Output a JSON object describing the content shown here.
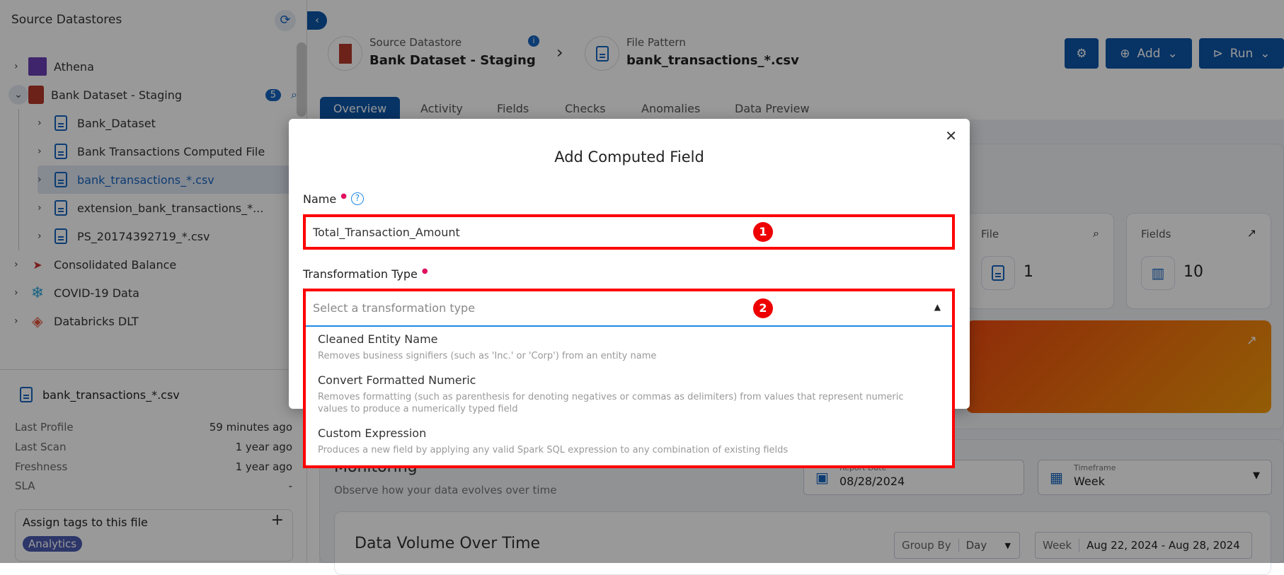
{
  "sidebar": {
    "title": "Source Datastores",
    "items": [
      {
        "label": "Athena"
      },
      {
        "label": "Bank Dataset - Staging",
        "badge": "5"
      },
      {
        "label": "Bank_Dataset"
      },
      {
        "label": "Bank Transactions Computed File"
      },
      {
        "label": "bank_transactions_*.csv"
      },
      {
        "label": "extension_bank_transactions_*..."
      },
      {
        "label": "PS_20174392719_*.csv"
      },
      {
        "label": "Consolidated Balance"
      },
      {
        "label": "COVID-19 Data"
      },
      {
        "label": "Databricks DLT"
      }
    ],
    "file": {
      "name": "bank_transactions_*.csv",
      "meta": [
        {
          "k": "Last Profile",
          "v": "59 minutes ago"
        },
        {
          "k": "Last Scan",
          "v": "1 year ago"
        },
        {
          "k": "Freshness",
          "v": "1 year ago"
        },
        {
          "k": "SLA",
          "v": "-"
        }
      ],
      "tags_label": "Assign tags to this file",
      "tags": [
        "Analytics"
      ]
    }
  },
  "header": {
    "ds_label": "Source Datastore",
    "ds_name": "Bank Dataset - Staging",
    "fp_label": "File Pattern",
    "fp_name": "bank_transactions_*.csv",
    "add": "Add",
    "run": "Run"
  },
  "tabs": [
    "Overview",
    "Activity",
    "Fields",
    "Checks",
    "Anomalies",
    "Data Preview"
  ],
  "cards": {
    "file_label": "File",
    "file_value": "1",
    "fields_label": "Fields",
    "fields_value": "10"
  },
  "monitoring": {
    "title": "Monitoring",
    "subtitle": "Observe how your data evolves over time",
    "report_date_label": "Report Date",
    "report_date": "08/28/2024",
    "timeframe_label": "Timeframe",
    "timeframe": "Week"
  },
  "volume": {
    "title": "Data Volume Over Time",
    "group_by_label": "Group By",
    "group_by": "Day",
    "range_label": "Week",
    "range": "Aug 22, 2024 - Aug 28, 2024"
  },
  "modal": {
    "title": "Add Computed Field",
    "name_label": "Name",
    "name_value": "Total_Transaction_Amount",
    "type_label": "Transformation Type",
    "type_placeholder": "Select a transformation type",
    "marker1": "1",
    "marker2": "2",
    "options": [
      {
        "title": "Cleaned Entity Name",
        "desc": "Removes business signifiers (such as 'Inc.' or 'Corp') from an entity name"
      },
      {
        "title": "Convert Formatted Numeric",
        "desc": "Removes formatting (such as parenthesis for denoting negatives or commas as delimiters) from values that represent numeric values to produce a numerically typed field"
      },
      {
        "title": "Custom Expression",
        "desc": "Produces a new field by applying any valid Spark SQL expression to any combination of existing fields"
      }
    ]
  },
  "colors": {
    "primary": "#0d56a8",
    "annotation": "#ff0000"
  }
}
